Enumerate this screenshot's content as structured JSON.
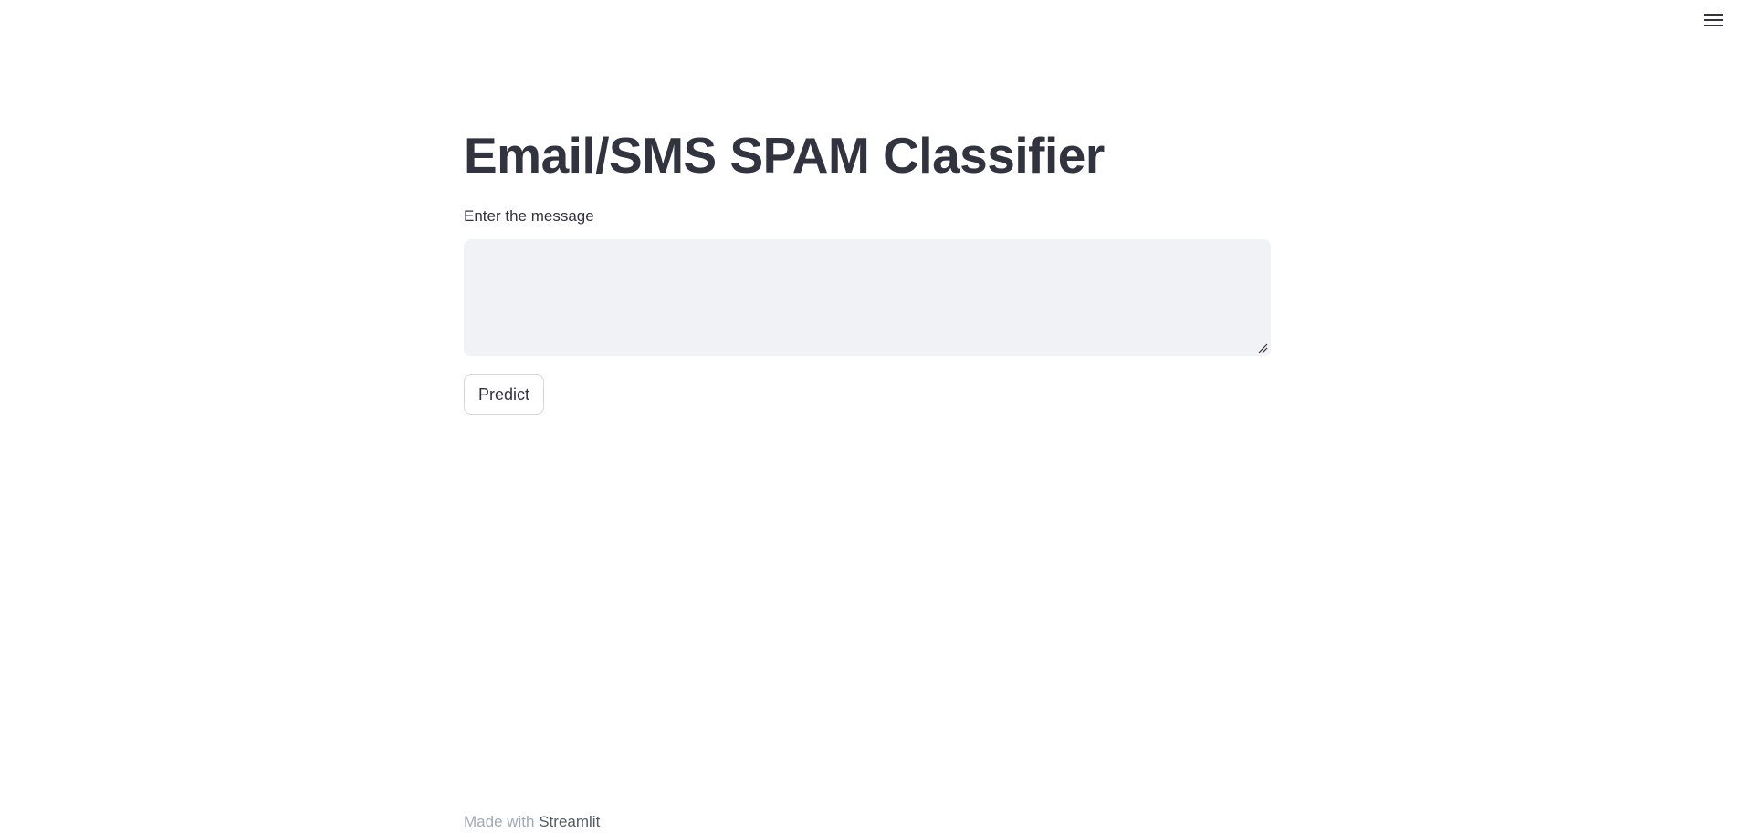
{
  "header": {
    "menu_icon": "hamburger-menu-icon"
  },
  "main": {
    "title": "Email/SMS SPAM Classifier",
    "message_field": {
      "label": "Enter the message",
      "value": "",
      "placeholder": ""
    },
    "predict_button": {
      "label": "Predict"
    }
  },
  "footer": {
    "made_with": "Made with",
    "brand": "Streamlit"
  },
  "colors": {
    "text": "#31333f",
    "input_background": "#f0f2f6",
    "footer_muted": "#a3a8b4",
    "button_border": "#d4d6dc"
  }
}
